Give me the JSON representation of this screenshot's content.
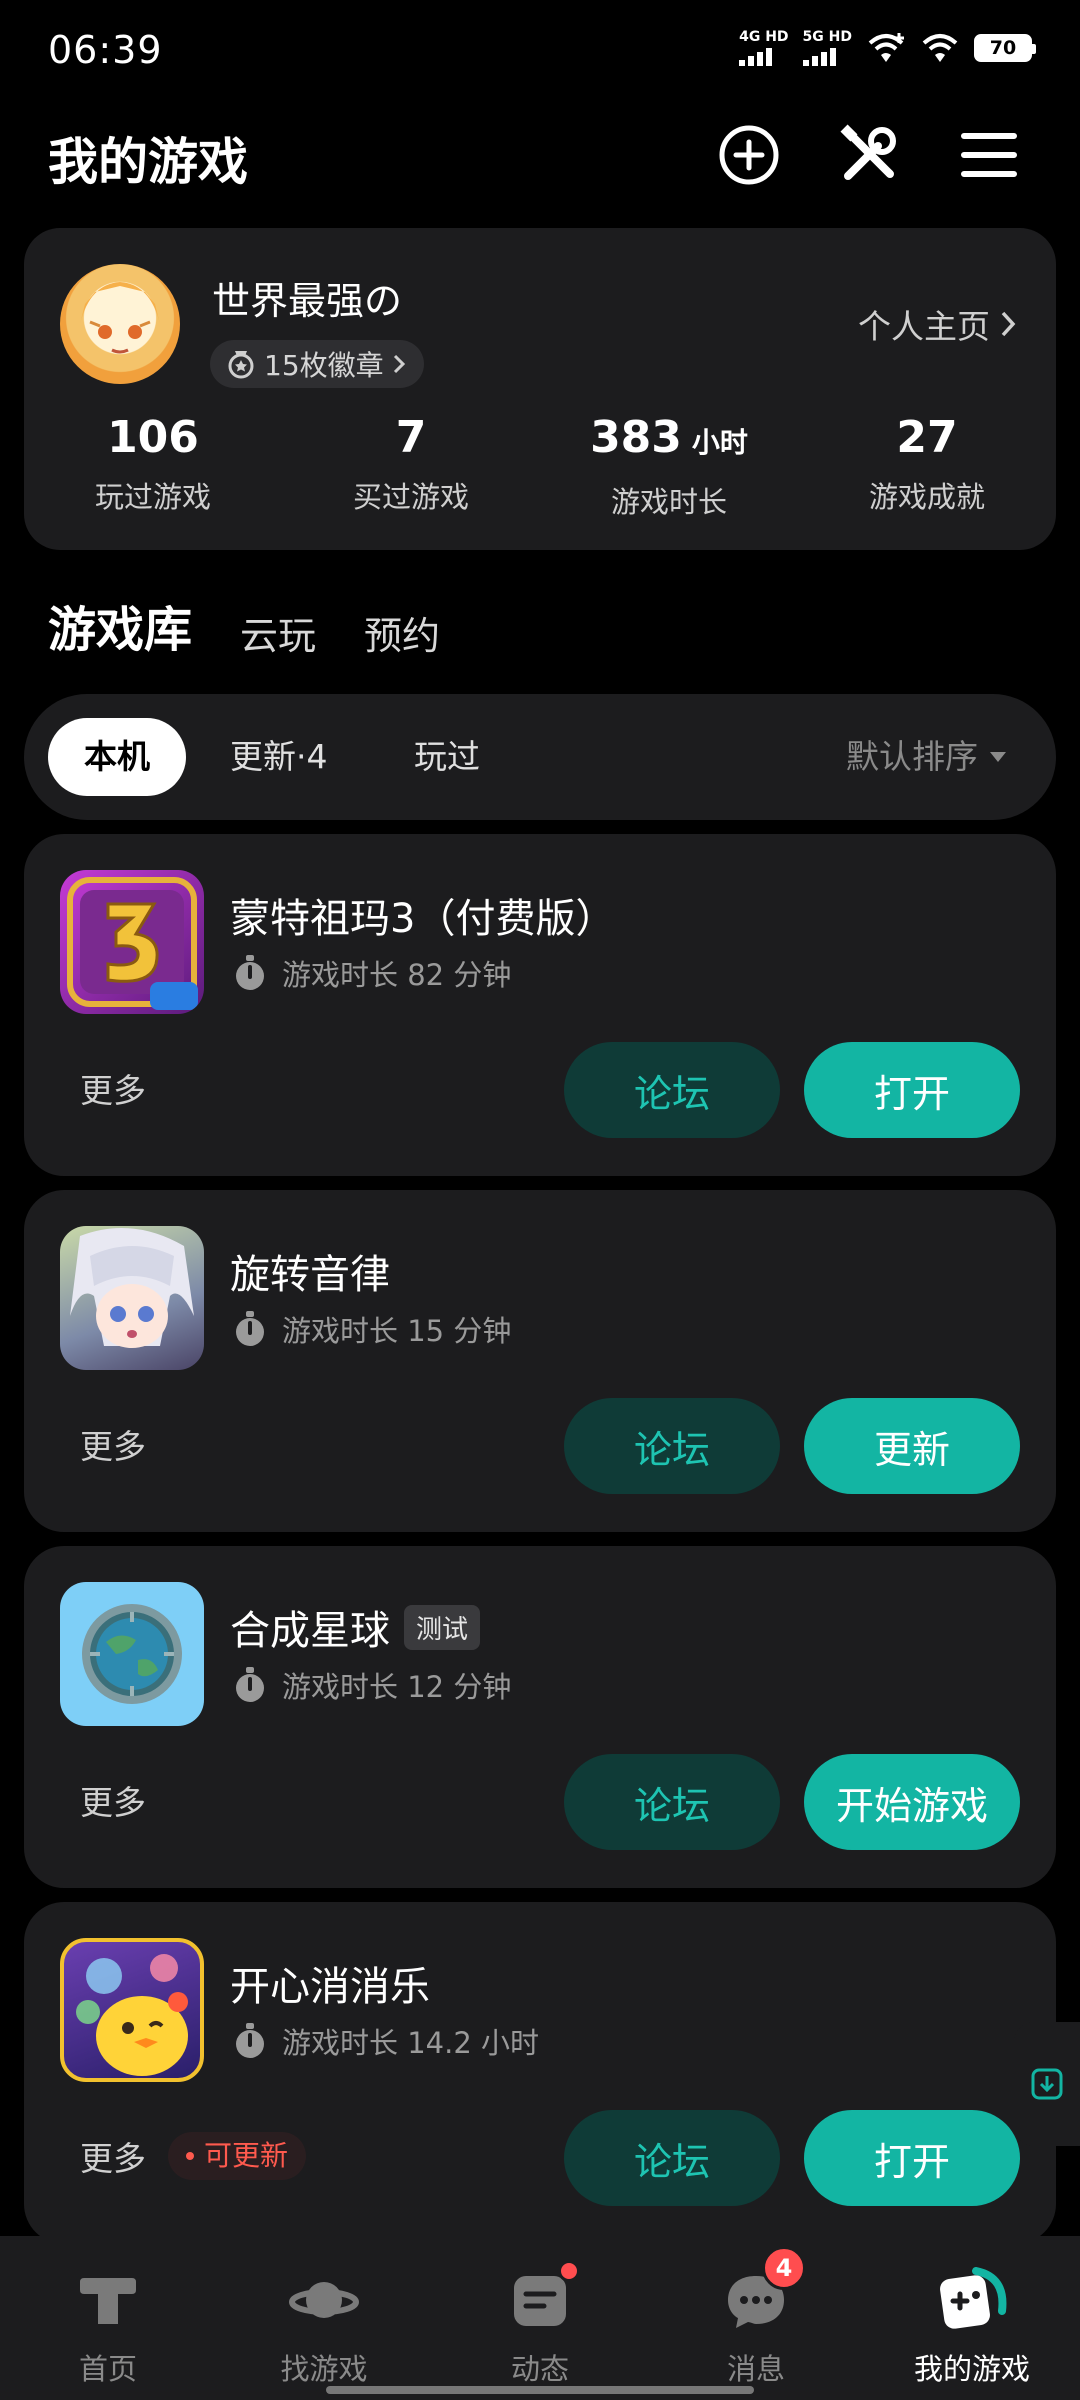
{
  "status_bar": {
    "time": "06:39",
    "net1": "4G HD",
    "net2": "5G HD",
    "battery": "70"
  },
  "header": {
    "title": "我的游戏",
    "icons": [
      "add-circle-icon",
      "tools-icon",
      "menu-icon"
    ]
  },
  "profile": {
    "username": "世界最强の",
    "badges": "15枚徽章",
    "homepage_link": "个人主页",
    "stats": [
      {
        "value": "106",
        "unit": "",
        "label": "玩过游戏"
      },
      {
        "value": "7",
        "unit": "",
        "label": "买过游戏"
      },
      {
        "value": "383",
        "unit": "小时",
        "label": "游戏时长"
      },
      {
        "value": "27",
        "unit": "",
        "label": "游戏成就"
      }
    ]
  },
  "tabs": [
    "游戏库",
    "云玩",
    "预约"
  ],
  "filters": {
    "chips": [
      "本机",
      "更新·4",
      "玩过"
    ],
    "sort": "默认排序"
  },
  "games": [
    {
      "name": "蒙特祖玛3（付费版）",
      "tag": "",
      "playtime": "游戏时长 82 分钟",
      "more": "更多",
      "update_tag": "",
      "forum": "论坛",
      "action": "打开"
    },
    {
      "name": "旋转音律",
      "tag": "",
      "playtime": "游戏时长 15 分钟",
      "more": "更多",
      "update_tag": "",
      "forum": "论坛",
      "action": "更新"
    },
    {
      "name": "合成星球",
      "tag": "测试",
      "playtime": "游戏时长 12 分钟",
      "more": "更多",
      "update_tag": "",
      "forum": "论坛",
      "action": "开始游戏"
    },
    {
      "name": "开心消消乐",
      "tag": "",
      "playtime": "游戏时长 14.2 小时",
      "more": "更多",
      "update_tag": "可更新",
      "forum": "论坛",
      "action": "打开"
    }
  ],
  "bottom_nav": {
    "items": [
      {
        "label": "首页",
        "icon": "home-icon"
      },
      {
        "label": "找游戏",
        "icon": "planet-icon"
      },
      {
        "label": "动态",
        "icon": "feed-icon"
      },
      {
        "label": "消息",
        "icon": "message-icon",
        "badge": "4"
      },
      {
        "label": "我的游戏",
        "icon": "gamepad-icon"
      }
    ]
  },
  "colors": {
    "accent": "#13b5a3",
    "card": "#1c1c1e",
    "background": "#000000",
    "alert": "#ff4d4f"
  }
}
